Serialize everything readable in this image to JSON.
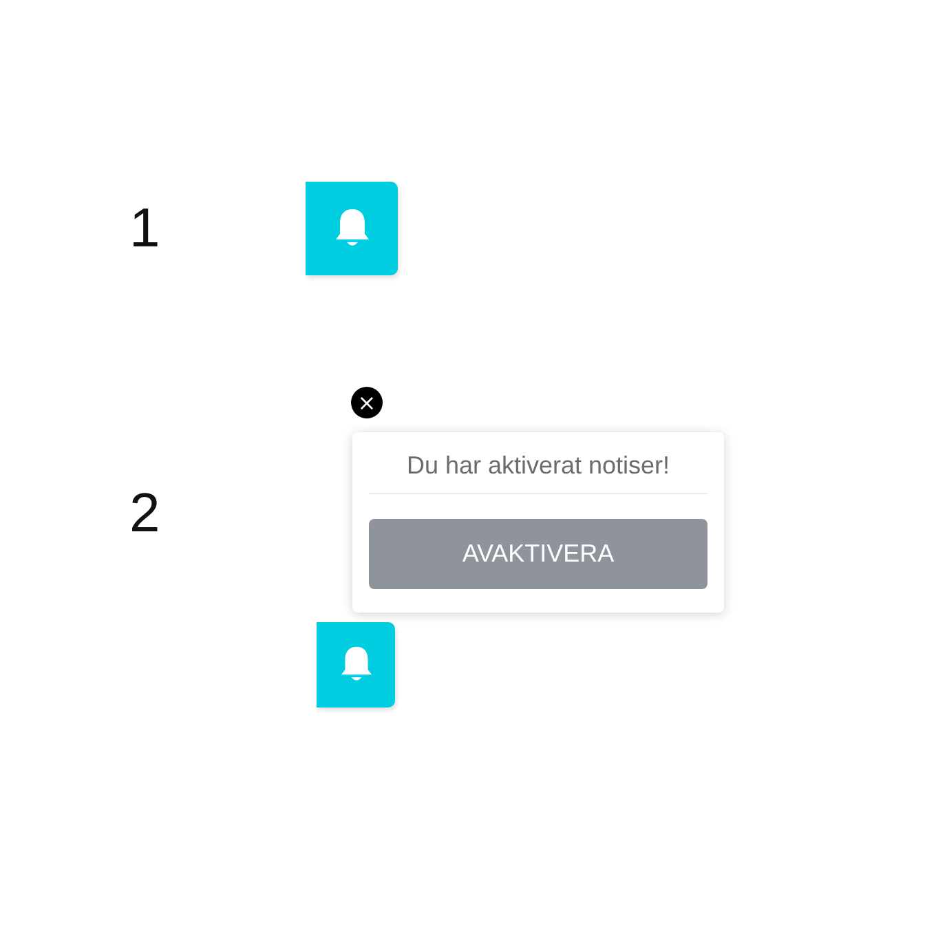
{
  "sections": [
    {
      "label": "1"
    },
    {
      "label": "2",
      "popup": {
        "close": "×",
        "message": "Du har aktiverat notiser!",
        "button": "AVAKTIVERA"
      }
    }
  ]
}
